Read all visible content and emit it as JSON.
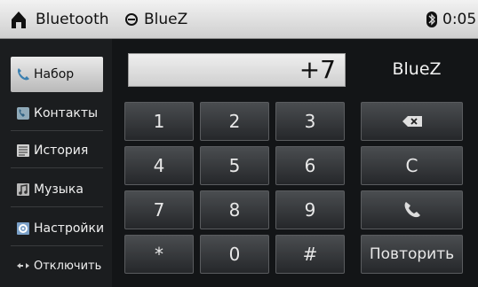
{
  "status_bar": {
    "title": "Bluetooth",
    "app_name": "BlueZ",
    "time": "0:05"
  },
  "sidebar": {
    "items": [
      {
        "label": "Набор",
        "icon": "phone-icon",
        "active": true
      },
      {
        "label": "Контакты",
        "icon": "contacts-icon",
        "active": false
      },
      {
        "label": "История",
        "icon": "history-icon",
        "active": false
      },
      {
        "label": "Музыка",
        "icon": "music-icon",
        "active": false
      },
      {
        "label": "Настройки",
        "icon": "settings-icon",
        "active": false
      },
      {
        "label": "Отключить",
        "icon": "disconnect-icon",
        "active": false
      }
    ]
  },
  "dialer": {
    "number": "+7",
    "device_name": "BlueZ",
    "keys": [
      "1",
      "2",
      "3",
      "4",
      "5",
      "6",
      "7",
      "8",
      "9",
      "*",
      "0",
      "#"
    ],
    "clear_label": "C",
    "redial_label": "Повторить"
  }
}
